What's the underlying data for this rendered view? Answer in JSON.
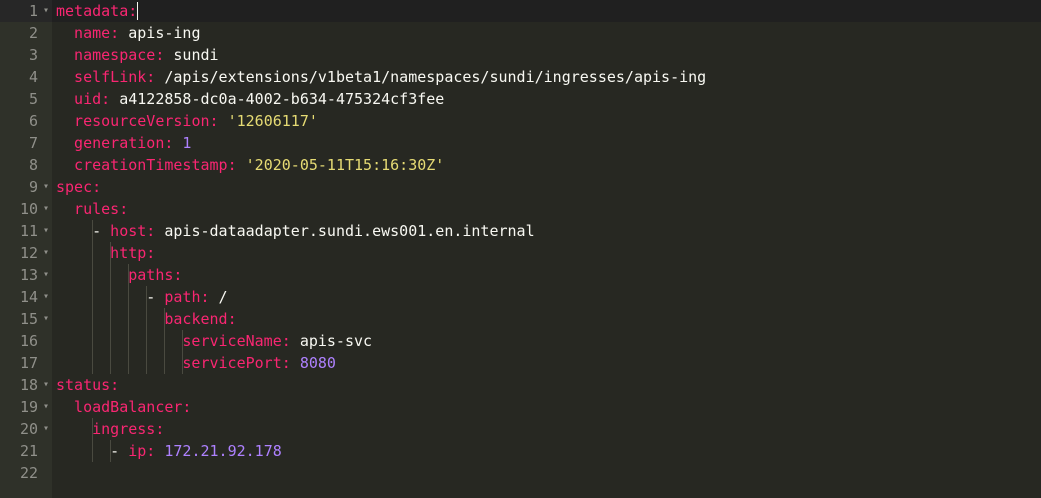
{
  "editor": {
    "lines": [
      {
        "num": "1",
        "fold": "▾",
        "key": "metadata:",
        "sep": "",
        "val": "",
        "vtype": "p",
        "indent": 0,
        "dash": false
      },
      {
        "num": "2",
        "fold": "",
        "key": "name:",
        "sep": " ",
        "val": "apis-ing",
        "vtype": "p",
        "indent": 1,
        "dash": false
      },
      {
        "num": "3",
        "fold": "",
        "key": "namespace:",
        "sep": " ",
        "val": "sundi",
        "vtype": "p",
        "indent": 1,
        "dash": false
      },
      {
        "num": "4",
        "fold": "",
        "key": "selfLink:",
        "sep": " ",
        "val": "/apis/extensions/v1beta1/namespaces/sundi/ingresses/apis-ing",
        "vtype": "p",
        "indent": 1,
        "dash": false
      },
      {
        "num": "5",
        "fold": "",
        "key": "uid:",
        "sep": " ",
        "val": "a4122858-dc0a-4002-b634-475324cf3fee",
        "vtype": "p",
        "indent": 1,
        "dash": false
      },
      {
        "num": "6",
        "fold": "",
        "key": "resourceVersion:",
        "sep": " ",
        "val": "'12606117'",
        "vtype": "s",
        "indent": 1,
        "dash": false
      },
      {
        "num": "7",
        "fold": "",
        "key": "generation:",
        "sep": " ",
        "val": "1",
        "vtype": "n",
        "indent": 1,
        "dash": false
      },
      {
        "num": "8",
        "fold": "",
        "key": "creationTimestamp:",
        "sep": " ",
        "val": "'2020-05-11T15:16:30Z'",
        "vtype": "s",
        "indent": 1,
        "dash": false
      },
      {
        "num": "9",
        "fold": "▾",
        "key": "spec:",
        "sep": "",
        "val": "",
        "vtype": "p",
        "indent": 0,
        "dash": false
      },
      {
        "num": "10",
        "fold": "▾",
        "key": "rules:",
        "sep": "",
        "val": "",
        "vtype": "p",
        "indent": 1,
        "dash": false
      },
      {
        "num": "11",
        "fold": "▾",
        "key": "host:",
        "sep": " ",
        "val": "apis-dataadapter.sundi.ews001.en.internal",
        "vtype": "p",
        "indent": 2,
        "dash": true
      },
      {
        "num": "12",
        "fold": "▾",
        "key": "http:",
        "sep": "",
        "val": "",
        "vtype": "p",
        "indent": 3,
        "dash": false
      },
      {
        "num": "13",
        "fold": "▾",
        "key": "paths:",
        "sep": "",
        "val": "",
        "vtype": "p",
        "indent": 4,
        "dash": false
      },
      {
        "num": "14",
        "fold": "▾",
        "key": "path:",
        "sep": " ",
        "val": "/",
        "vtype": "p",
        "indent": 5,
        "dash": true
      },
      {
        "num": "15",
        "fold": "▾",
        "key": "backend:",
        "sep": "",
        "val": "",
        "vtype": "p",
        "indent": 6,
        "dash": false
      },
      {
        "num": "16",
        "fold": "",
        "key": "serviceName:",
        "sep": " ",
        "val": "apis-svc",
        "vtype": "p",
        "indent": 7,
        "dash": false
      },
      {
        "num": "17",
        "fold": "",
        "key": "servicePort:",
        "sep": " ",
        "val": "8080",
        "vtype": "n",
        "indent": 7,
        "dash": false
      },
      {
        "num": "18",
        "fold": "▾",
        "key": "status:",
        "sep": "",
        "val": "",
        "vtype": "p",
        "indent": 0,
        "dash": false
      },
      {
        "num": "19",
        "fold": "▾",
        "key": "loadBalancer:",
        "sep": "",
        "val": "",
        "vtype": "p",
        "indent": 1,
        "dash": false
      },
      {
        "num": "20",
        "fold": "▾",
        "key": "ingress:",
        "sep": "",
        "val": "",
        "vtype": "p",
        "indent": 2,
        "dash": false
      },
      {
        "num": "21",
        "fold": "",
        "key": "ip:",
        "sep": " ",
        "val": "172.21.92.178",
        "vtype": "n",
        "indent": 3,
        "dash": true
      },
      {
        "num": "22",
        "fold": "",
        "key": "",
        "sep": "",
        "val": "",
        "vtype": "p",
        "indent": 0,
        "dash": false
      }
    ],
    "colors": {
      "background": "#272822",
      "gutter": "#2f3129",
      "key": "#f92672",
      "string": "#e6db74",
      "number": "#ae81ff",
      "text": "#f8f8f2"
    }
  }
}
